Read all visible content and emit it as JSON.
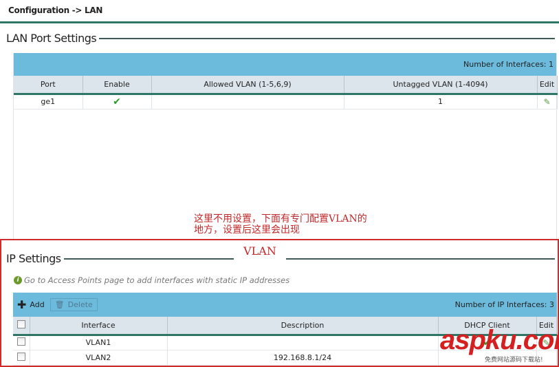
{
  "breadcrumb": "Configuration -> LAN",
  "lan": {
    "title": "LAN Port Settings",
    "count_label": "Number of Interfaces:",
    "count": "1",
    "columns": [
      "Port",
      "Enable",
      "Allowed VLAN (1-5,6,9)",
      "Untagged VLAN (1-4094)",
      "Edit"
    ],
    "rows": [
      {
        "port": "ge1",
        "enabled": true,
        "allowed": "",
        "untagged": "1"
      }
    ]
  },
  "annotation": {
    "line1": "这里不用设置，下面有专门配置VLAN的",
    "line2": "地方，设置后这里会出现",
    "vlan": "VLAN"
  },
  "ip": {
    "title": "IP Settings",
    "info": "Go to Access Points page to add interfaces with static IP addresses",
    "add": "Add",
    "delete": "Delete",
    "count_label": "Number of IP Interfaces:",
    "count": "3",
    "columns": [
      "Interface",
      "Description",
      "DHCP Client",
      "Edit"
    ],
    "rows": [
      {
        "iface": "VLAN1",
        "desc": ""
      },
      {
        "iface": "VLAN2",
        "desc": "192.168.8.1/24"
      }
    ]
  },
  "watermark": {
    "logo": "aspku.com",
    "sub": "免费网站源码下载站!"
  },
  "colors": {
    "accent": "#2e7565",
    "bar": "#6cbbdc",
    "annotation": "#c0282a"
  }
}
